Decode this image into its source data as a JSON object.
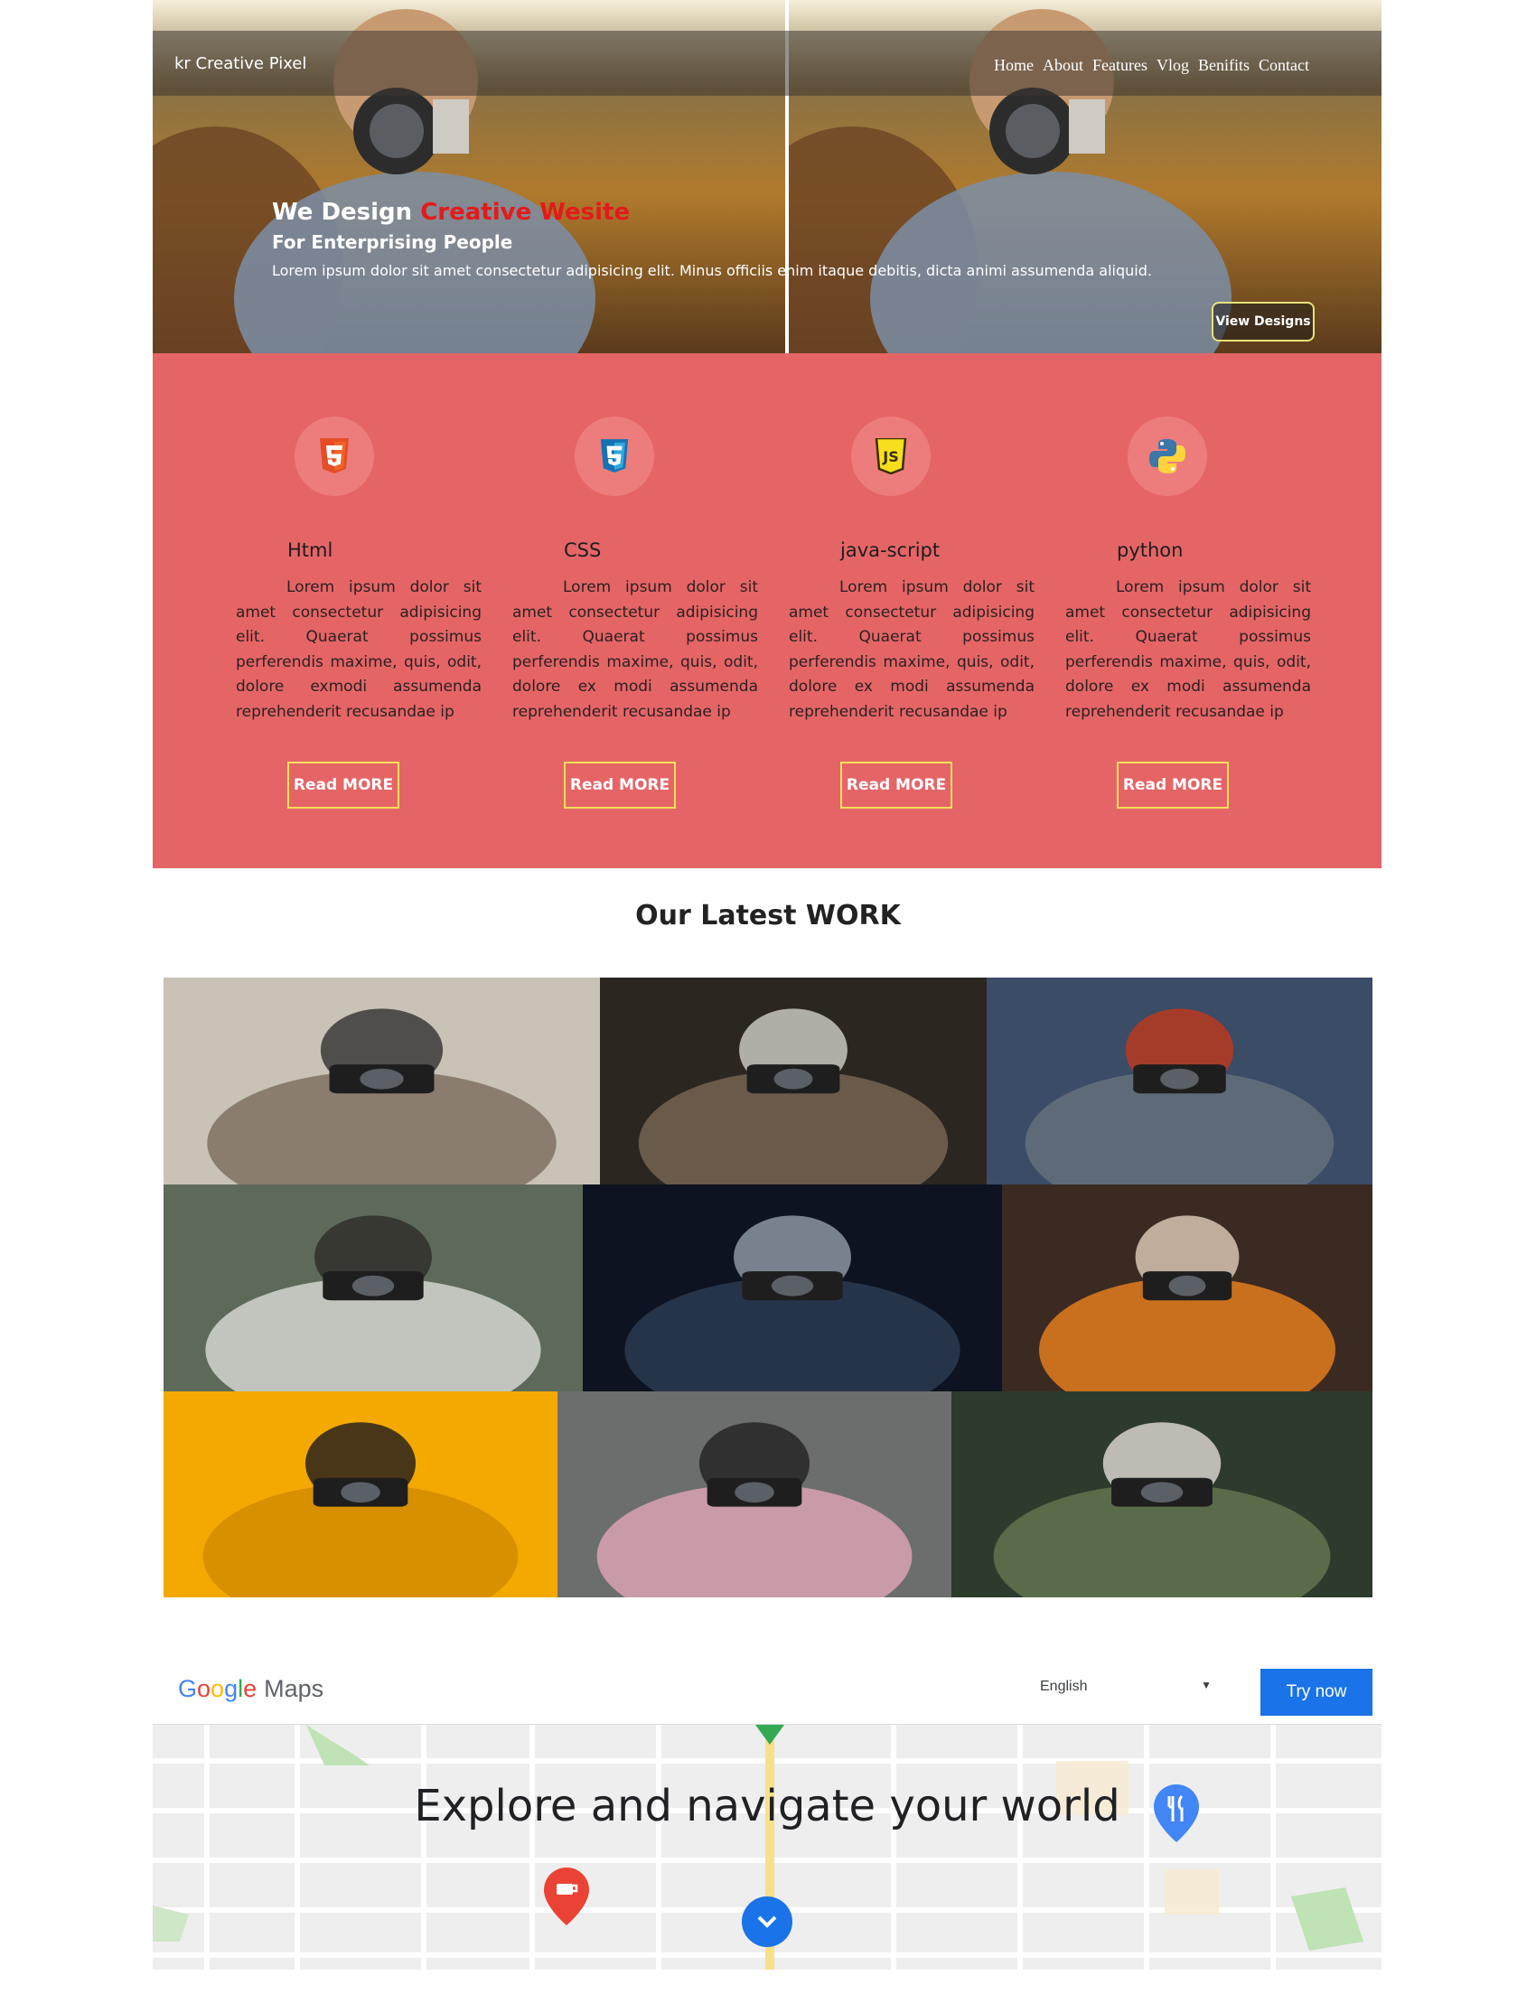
{
  "navbar": {
    "brand": "kr Creative Pixel",
    "links": [
      "Home",
      "About",
      "Features",
      "Vlog",
      "Benifits",
      "Contact"
    ]
  },
  "hero": {
    "heading_prefix": "We Design ",
    "heading_accent": "Creative Wesite",
    "subheading": "For Enterprising People",
    "text": "Lorem ipsum dolor sit amet consectetur adipisicing elit. Minus officiis enim itaque debitis, dicta animi assumenda aliquid.",
    "button": "View Designs"
  },
  "features": [
    {
      "title": "Html",
      "icon": "html5-icon",
      "text": "Lorem ipsum dolor sit amet consectetur adipisicing elit. Quaerat possimus perferendis maxime, quis, odit, dolore exmodi assumenda reprehenderit recusandae ip",
      "button": "Read MORE"
    },
    {
      "title": "CSS",
      "icon": "css3-icon",
      "text": "Lorem ipsum dolor sit amet consectetur adipisicing elit. Quaerat possimus perferendis maxime, quis, odit, dolore ex modi assumenda reprehenderit recusandae ip",
      "button": "Read MORE"
    },
    {
      "title": "java-script",
      "icon": "javascript-icon",
      "text": "Lorem ipsum dolor sit amet consectetur adipisicing elit. Quaerat possimus perferendis maxime, quis, odit, dolore ex modi assumenda reprehenderit recusandae ip",
      "button": "Read MORE"
    },
    {
      "title": "python",
      "icon": "python-icon",
      "text": "Lorem ipsum dolor sit amet consectetur adipisicing elit. Quaerat possimus perferendis maxime, quis, odit, dolore ex modi assumenda reprehenderit recusandae ip",
      "button": "Read MORE"
    }
  ],
  "work": {
    "title": "Our Latest WORK",
    "photos": [
      {
        "name": "photo-gimbal-videographer",
        "colors": [
          "#c9c2b7",
          "#8a7d6f",
          "#3a3a38"
        ]
      },
      {
        "name": "photo-woman-vintage-camera",
        "colors": [
          "#2b2620",
          "#6a5a4a",
          "#c8c8c0"
        ]
      },
      {
        "name": "photo-hand-holding-camera-trees",
        "colors": [
          "#3a4c66",
          "#5e6a78",
          "#b83a1e"
        ]
      },
      {
        "name": "photo-hand-compass-camera",
        "colors": [
          "#5d6a5a",
          "#c2c5be",
          "#2f2f2a"
        ]
      },
      {
        "name": "photo-dark-woman-camera",
        "colors": [
          "#0d1320",
          "#26344a",
          "#8b96a2"
        ]
      },
      {
        "name": "photo-woman-orange-camera",
        "colors": [
          "#3b2a22",
          "#c9701e",
          "#d8c4b0"
        ]
      },
      {
        "name": "photo-woman-hat-yellow",
        "colors": [
          "#f4a900",
          "#d88f00",
          "#2a221d"
        ]
      },
      {
        "name": "photo-woman-camera-street",
        "colors": [
          "#6b6e6c",
          "#c99aa8",
          "#262626"
        ]
      },
      {
        "name": "photo-woman-camera-forest",
        "colors": [
          "#2d3b2c",
          "#5a6b4a",
          "#d7d2cc"
        ]
      }
    ]
  },
  "maps": {
    "logo_letters": [
      "G",
      "o",
      "o",
      "g",
      "l",
      "e"
    ],
    "logo_suffix": "Maps",
    "language": "English",
    "try_button": "Try now",
    "headline": "Explore and navigate your world"
  },
  "colors": {
    "features_bg": "#e56566",
    "accent_red": "#e41a1a",
    "button_border": "#f4e05a",
    "maps_blue": "#1a73e8"
  }
}
